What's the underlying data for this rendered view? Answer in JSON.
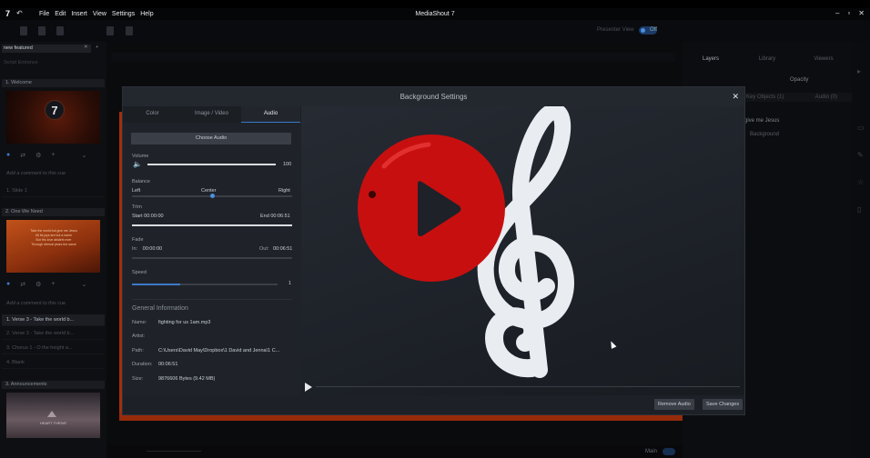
{
  "app": {
    "logo": "7",
    "title": "MediaShout 7",
    "menu": [
      "File",
      "Edit",
      "Insert",
      "View",
      "Settings",
      "Help"
    ]
  },
  "toolbar": {
    "presenter_label": "Presenter View",
    "toggle_value": "Off"
  },
  "left_panel": {
    "search_value": "new featured",
    "sub_label": "Script Entrance",
    "sections": [
      {
        "header": "1. Welcome",
        "comment": "Add a comment to this cue",
        "slide": "1. Slide 1"
      },
      {
        "header": "2. One We Need",
        "comment": "Add a comment to this cue",
        "thumb_lines": [
          "Take the world but give me Jesus",
          "All its joys are but a name",
          "But His love abideth ever",
          "Through eternal years the same"
        ],
        "slides": [
          "1. Verse 3 - Take the world b...",
          "2. Verse 3 - Take the world b...",
          "3. Chorus 1 - O the height a...",
          "4. Blank"
        ]
      },
      {
        "header": "3. Announcements",
        "thumb_caption": "HEART THRIVE"
      }
    ]
  },
  "right_panel": {
    "tabs": [
      "Layers",
      "Library",
      "Viewers"
    ],
    "opacity_label": "Opacity",
    "columns": [
      "Key Objects (1)",
      "Audio (0)"
    ],
    "rows": [
      "give me Jesus",
      "Background"
    ]
  },
  "bottombar": {
    "label": "Main"
  },
  "dialog": {
    "title": "Background Settings",
    "tabs": [
      "Color",
      "Image / Video",
      "Audio"
    ],
    "active_tab": "Audio",
    "choose_audio": "Choose Audio",
    "volume": {
      "label": "Volume",
      "value": "100",
      "level": 1.0
    },
    "balance": {
      "label": "Balance",
      "left": "Left",
      "center": "Center",
      "right": "Right",
      "level": 0.5
    },
    "trim": {
      "label": "Trim",
      "start_label": "Start",
      "start": "00:00:00",
      "end_label": "End",
      "end": "00:06:51"
    },
    "fade": {
      "label": "Fade",
      "in_label": "In:",
      "in": "00:00:00",
      "out_label": "Out:",
      "out": "00:06:51"
    },
    "speed": {
      "label": "Speed",
      "value": "1",
      "level": 0.33
    },
    "general_info": {
      "heading": "General Information",
      "rows": [
        {
          "key": "Name:",
          "value": "fighting for us 1am.mp3"
        },
        {
          "key": "Artist:",
          "value": ""
        },
        {
          "key": "Path:",
          "value": "C:\\Users\\David May\\Dropbox\\1 David and Jenna\\1 C..."
        },
        {
          "key": "Duration:",
          "value": "00:06:51"
        },
        {
          "key": "Size:",
          "value": "9876606 Bytes (9.42 MB)"
        }
      ]
    },
    "remove_audio": "Remove Audio",
    "save_changes": "Save Changes"
  },
  "colors": {
    "accent": "#3c79c8",
    "play_red": "#c80f0f",
    "orange": "#c43a12",
    "clef": "#e9ecf1"
  }
}
